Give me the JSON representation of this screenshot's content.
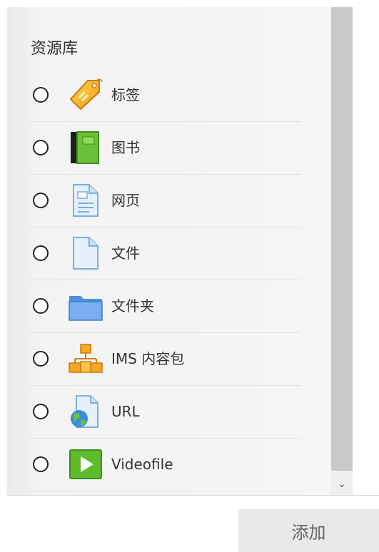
{
  "section": {
    "title": "资源库"
  },
  "items": [
    {
      "label": "标签",
      "icon": "tag-icon"
    },
    {
      "label": "图书",
      "icon": "book-icon"
    },
    {
      "label": "网页",
      "icon": "page-icon"
    },
    {
      "label": "文件",
      "icon": "file-icon"
    },
    {
      "label": "文件夹",
      "icon": "folder-icon"
    },
    {
      "label": "IMS 内容包",
      "icon": "ims-package-icon"
    },
    {
      "label": "URL",
      "icon": "url-icon"
    },
    {
      "label": "Videofile",
      "icon": "video-icon"
    }
  ],
  "footer": {
    "add_label": "添加"
  },
  "scrollbar": {
    "down_arrow": "⌄"
  }
}
